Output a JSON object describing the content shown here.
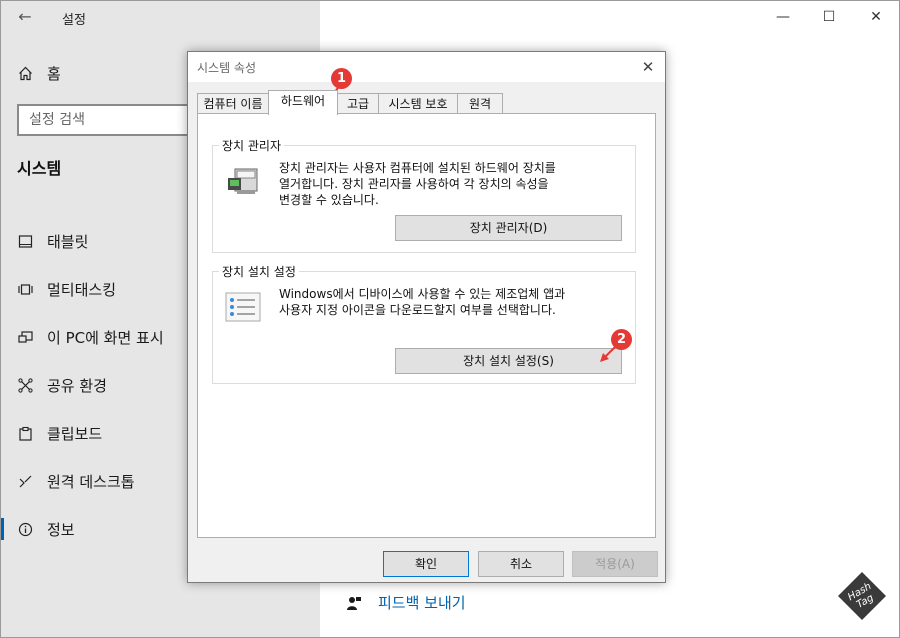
{
  "settings": {
    "app_title": "설정",
    "home_label": "홈",
    "search_placeholder": "설정 검색",
    "section_title": "시스템",
    "nav_items": [
      {
        "label": "태블릿",
        "icon": "tablet-icon"
      },
      {
        "label": "멀티태스킹",
        "icon": "multitasking-icon"
      },
      {
        "label": "이 PC에 화면 표시",
        "icon": "project-icon"
      },
      {
        "label": "공유 환경",
        "icon": "share-icon"
      },
      {
        "label": "클립보드",
        "icon": "clipboard-icon"
      },
      {
        "label": "원격 데스크톱",
        "icon": "remote-desktop-icon"
      },
      {
        "label": "정보",
        "icon": "info-icon",
        "active": true
      }
    ],
    "feedback_label": "피드백 보내기",
    "accent_color": "#0063b1"
  },
  "dialog": {
    "title": "시스템 속성",
    "tabs": [
      "컴퓨터 이름",
      "하드웨어",
      "고급",
      "시스템 보호",
      "원격"
    ],
    "active_tab": "하드웨어",
    "device_manager": {
      "group_label": "장치 관리자",
      "description_lines": [
        "장치 관리자는 사용자 컴퓨터에 설치된 하드웨어 장치를",
        "열거합니다. 장치 관리자를 사용하여 각 장치의 속성을",
        "변경할 수 있습니다."
      ],
      "button_label": "장치 관리자(D)"
    },
    "device_install": {
      "group_label": "장치 설치 설정",
      "description_lines": [
        "Windows에서 디바이스에 사용할 수 있는 제조업체 앱과",
        "사용자 지정 아이콘을 다운로드할지 여부를 선택합니다."
      ],
      "button_label": "장치 설치 설정(S)"
    },
    "buttons": {
      "ok": "확인",
      "cancel": "취소",
      "apply": "적용(A)"
    }
  },
  "annotations": {
    "badge1": "1",
    "badge2": "2",
    "badge_color": "#e53935"
  },
  "logo": {
    "line1": "Hash",
    "line2": "Tag"
  }
}
